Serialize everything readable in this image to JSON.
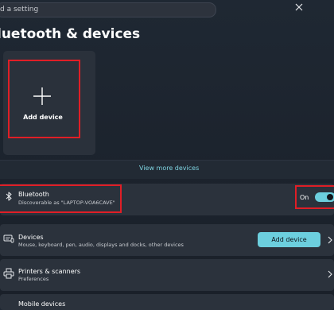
{
  "search": {
    "placeholder_text": "d a setting"
  },
  "page": {
    "title": "luetooth & devices"
  },
  "add_tile": {
    "label": "Add device"
  },
  "view_more": {
    "label": "View more devices"
  },
  "bluetooth_row": {
    "title": "Bluetooth",
    "subtitle": "Discoverable as \"LAPTOP-VOA6CAVE\"",
    "toggle_label": "On",
    "toggle_on": true
  },
  "devices_row": {
    "title": "Devices",
    "subtitle": "Mouse, keyboard, pen, audio, displays and docks, other devices",
    "button_label": "Add device"
  },
  "printers_row": {
    "title": "Printers & scanners",
    "subtitle": "Preferences"
  },
  "mobile_row": {
    "title": "Mobile devices"
  },
  "icons": {
    "search_close": "close-icon",
    "add": "plus-icon",
    "bluetooth": "bluetooth-icon",
    "devices": "keyboard-mouse-icon",
    "printers": "printer-icon",
    "chevron": "chevron-right-icon"
  },
  "colors": {
    "accent": "#6ccfde",
    "highlight": "#e01e26",
    "background": "#1f2833",
    "card": "#2b323c"
  }
}
